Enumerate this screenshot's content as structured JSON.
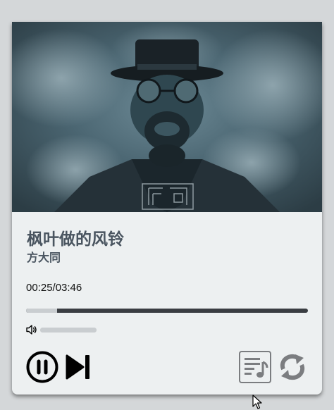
{
  "player": {
    "song_title": "枫叶做的风铃",
    "artist": "方大同",
    "current_time": "00:25",
    "duration": "03:46",
    "time_display": "00:25/03:46",
    "progress_fraction": 0.11,
    "volume_fraction": 1.0,
    "cover_art_watermark": "厄嗎"
  },
  "icons": {
    "volume": "speaker-icon",
    "pause": "pause-circle-icon",
    "next": "skip-next-icon",
    "playlist": "playlist-music-icon",
    "repeat": "repeat-icon"
  },
  "colors": {
    "card_background": "#edf0f1",
    "page_background": "#d4d7d9",
    "text_title": "#4a5560",
    "progress_track": "#3a3d42",
    "progress_played": "#c9cdd0",
    "control_dark": "#000000",
    "control_gray": "#7b7d80"
  }
}
